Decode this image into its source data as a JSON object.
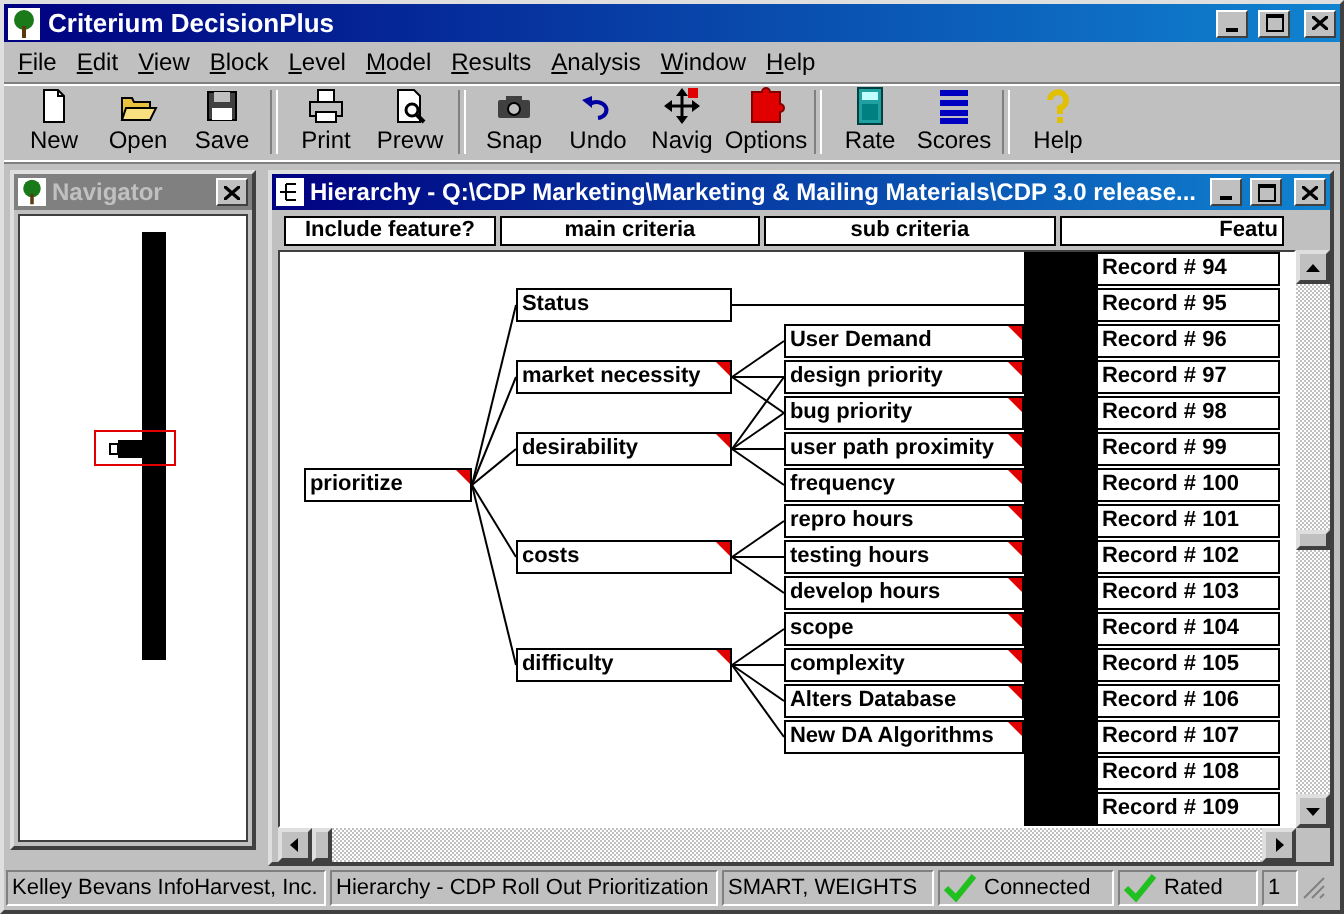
{
  "app": {
    "title": "Criterium DecisionPlus"
  },
  "menu": [
    "File",
    "Edit",
    "View",
    "Block",
    "Level",
    "Model",
    "Results",
    "Analysis",
    "Window",
    "Help"
  ],
  "toolbar": [
    [
      {
        "label": "New"
      },
      {
        "label": "Open"
      },
      {
        "label": "Save"
      }
    ],
    [
      {
        "label": "Print"
      },
      {
        "label": "Prevw"
      }
    ],
    [
      {
        "label": "Snap"
      },
      {
        "label": "Undo"
      },
      {
        "label": "Navig"
      },
      {
        "label": "Options"
      }
    ],
    [
      {
        "label": "Rate"
      },
      {
        "label": "Scores"
      }
    ],
    [
      {
        "label": "Help"
      }
    ]
  ],
  "navigator": {
    "title": "Navigator",
    "active": false
  },
  "hierarchy": {
    "title": "Hierarchy - Q:\\CDP Marketing\\Marketing & Mailing Materials\\CDP 3.0 release...",
    "active": true,
    "columns": [
      "Include feature?",
      "main criteria",
      "sub criteria",
      "Featu"
    ],
    "goal": {
      "label": "prioritize",
      "marked": true
    },
    "criteria": [
      {
        "label": "Status",
        "marked": false
      },
      {
        "label": "market necessity",
        "marked": true
      },
      {
        "label": "desirability",
        "marked": true
      },
      {
        "label": "costs",
        "marked": true
      },
      {
        "label": "difficulty",
        "marked": true
      }
    ],
    "sub_criteria": [
      {
        "label": "User Demand",
        "marked": true
      },
      {
        "label": "design priority",
        "marked": true
      },
      {
        "label": "bug priority",
        "marked": true
      },
      {
        "label": "user path proximity",
        "marked": true
      },
      {
        "label": "frequency",
        "marked": true
      },
      {
        "label": "repro hours",
        "marked": true
      },
      {
        "label": "testing hours",
        "marked": true
      },
      {
        "label": "develop hours",
        "marked": true
      },
      {
        "label": "scope",
        "marked": true
      },
      {
        "label": "complexity",
        "marked": true
      },
      {
        "label": "Alters Database",
        "marked": true
      },
      {
        "label": "New DA Algorithms",
        "marked": true
      }
    ],
    "records": [
      "Record # 94",
      "Record # 95",
      "Record # 96",
      "Record # 97",
      "Record # 98",
      "Record # 99",
      "Record # 100",
      "Record # 101",
      "Record # 102",
      "Record # 103",
      "Record # 104",
      "Record # 105",
      "Record # 106",
      "Record # 107",
      "Record # 108",
      "Record # 109"
    ]
  },
  "status_bar": [
    {
      "text": "Kelley Bevans InfoHarvest, Inc.",
      "checked": false
    },
    {
      "text": "Hierarchy - CDP Roll Out Prioritization",
      "checked": false
    },
    {
      "text": "SMART, WEIGHTS",
      "checked": false
    },
    {
      "text": "Connected",
      "checked": true
    },
    {
      "text": "Rated",
      "checked": true
    },
    {
      "text": "1",
      "checked": false
    }
  ]
}
